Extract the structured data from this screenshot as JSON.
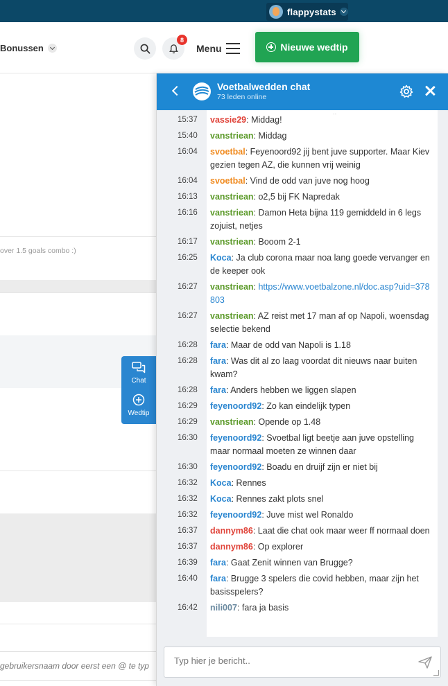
{
  "top_bar": {
    "brand": "flappystats",
    "accent": "#0c4867"
  },
  "nav": {
    "bonus_label": "Bonussen",
    "notification_count": "8",
    "menu_label": "Menu",
    "new_tip_label": "Nieuwe wedtip",
    "new_tip_color": "#21a453"
  },
  "background_page": {
    "note_text": "over 1.5 goals combo :)",
    "reply_hint": "gebruikersnaam door eerst een @ te typ"
  },
  "side_tabs": {
    "chat_label": "Chat",
    "wedtip_label": "Wedtip"
  },
  "chat": {
    "title": "Voetbalwedden chat",
    "members_online": "73 leden online",
    "header_color": "#1e88d3",
    "composer_placeholder": "Typ hier je bericht..",
    "messages": [
      {
        "time": "15:37",
        "user": "vassie29",
        "color": "#e0443a",
        "text": "Middag!"
      },
      {
        "time": "15:40",
        "user": "vanstriean",
        "color": "#5c9a2a",
        "text": "Middag"
      },
      {
        "time": "16:04",
        "user": "svoetbal",
        "color": "#f08a1e",
        "text": "Feyenoord92 jij bent juve supporter. Maar Kiev gezien tegen AZ, die kunnen vrij weinig"
      },
      {
        "time": "16:04",
        "user": "svoetbal",
        "color": "#f08a1e",
        "text": "Vind de odd van juve nog hoog"
      },
      {
        "time": "16:13",
        "user": "vanstriean",
        "color": "#5c9a2a",
        "text": "o2,5 bij FK Napredak"
      },
      {
        "time": "16:16",
        "user": "vanstriean",
        "color": "#5c9a2a",
        "text": "Damon Heta bijna 119 gemiddeld in 6 legs zojuist, netjes"
      },
      {
        "time": "16:17",
        "user": "vanstriean",
        "color": "#5c9a2a",
        "text": "Booom 2-1"
      },
      {
        "time": "16:25",
        "user": "Koca",
        "color": "#2a86d0",
        "text": "Ja club corona maar noa lang goede vervanger en de keeper ook"
      },
      {
        "time": "16:27",
        "user": "vanstriean",
        "color": "#5c9a2a",
        "text": "",
        "link": "https://www.voetbalzone.nl/doc.asp?uid=378803"
      },
      {
        "time": "16:27",
        "user": "vanstriean",
        "color": "#5c9a2a",
        "text": "AZ reist met 17 man af op Napoli, woensdag selectie bekend"
      },
      {
        "time": "16:28",
        "user": "fara",
        "color": "#2a86d0",
        "text": "Maar de odd van Napoli is 1.18"
      },
      {
        "time": "16:28",
        "user": "fara",
        "color": "#2a86d0",
        "text": "Was dit al zo laag voordat dit nieuws naar buiten kwam?"
      },
      {
        "time": "16:28",
        "user": "fara",
        "color": "#2a86d0",
        "text": "Anders hebben we liggen slapen"
      },
      {
        "time": "16:29",
        "user": "feyenoord92",
        "color": "#2a86d0",
        "text": "Zo kan eindelijk typen"
      },
      {
        "time": "16:29",
        "user": "vanstriean",
        "color": "#5c9a2a",
        "text": "Opende op 1.48"
      },
      {
        "time": "16:30",
        "user": "feyenoord92",
        "color": "#2a86d0",
        "text": "Svoetbal ligt beetje aan juve opstelling maar normaal moeten ze winnen daar"
      },
      {
        "time": "16:30",
        "user": "feyenoord92",
        "color": "#2a86d0",
        "text": "Boadu en druijf zijn er niet bij"
      },
      {
        "time": "16:32",
        "user": "Koca",
        "color": "#2a86d0",
        "text": "Rennes"
      },
      {
        "time": "16:32",
        "user": "Koca",
        "color": "#2a86d0",
        "text": "Rennes zakt plots snel"
      },
      {
        "time": "16:32",
        "user": "feyenoord92",
        "color": "#2a86d0",
        "text": "Juve mist wel Ronaldo"
      },
      {
        "time": "16:37",
        "user": "dannym86",
        "color": "#e0443a",
        "text": "Laat die chat ook maar weer ff normaal doen"
      },
      {
        "time": "16:37",
        "user": "dannym86",
        "color": "#e0443a",
        "text": "Op explorer"
      },
      {
        "time": "16:39",
        "user": "fara",
        "color": "#2a86d0",
        "text": "Gaat Zenit winnen van Brugge?"
      },
      {
        "time": "16:40",
        "user": "fara",
        "color": "#2a86d0",
        "text": "Brugge 3 spelers die covid hebben, maar zijn het basisspelers?"
      },
      {
        "time": "16:42",
        "user": "nili007",
        "color": "#6b8aa0",
        "text": "fara ja basis"
      }
    ]
  }
}
